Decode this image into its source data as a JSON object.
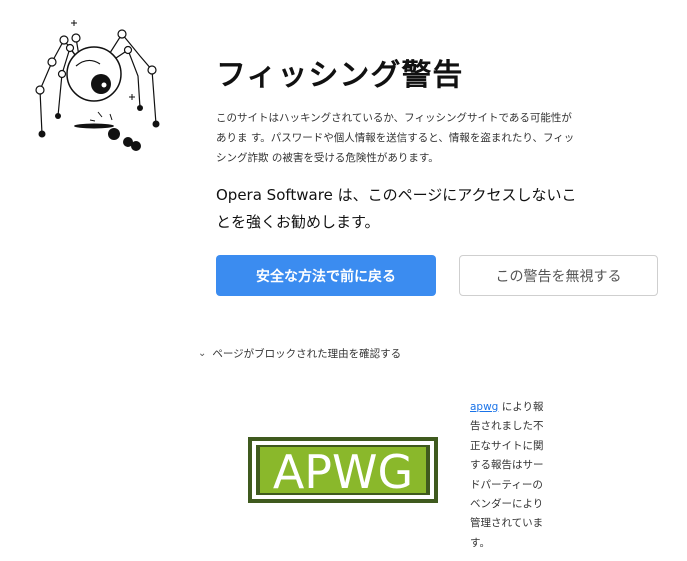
{
  "warning": {
    "title": "フィッシング警告",
    "description": "このサイトはハッキングされているか、フィッシングサイトである可能性がありま す。パスワードや個人情報を送信すると、情報を盗まれたり、フィッシング詐欺 の被害を受ける危険性があります。",
    "recommendation": "Opera Software は、このページにアクセスしないことを強くお勧めします。"
  },
  "actions": {
    "back_label": "安全な方法で前に戻る",
    "ignore_label": "この警告を無視する"
  },
  "details": {
    "chevron_icon": "chevron-down-icon",
    "toggle_label": "ページがブロックされた理由を確認する"
  },
  "provider": {
    "logo_text": "APWG",
    "link_text": "apwg",
    "text": " により報告されました不正なサイトに関する報告はサードパーティーのベンダーにより管理されています。",
    "logo_colors": {
      "green": "#8ab82b",
      "dark": "#3f5a1e"
    }
  },
  "illustration": {
    "name": "phishing-spider-icon"
  }
}
